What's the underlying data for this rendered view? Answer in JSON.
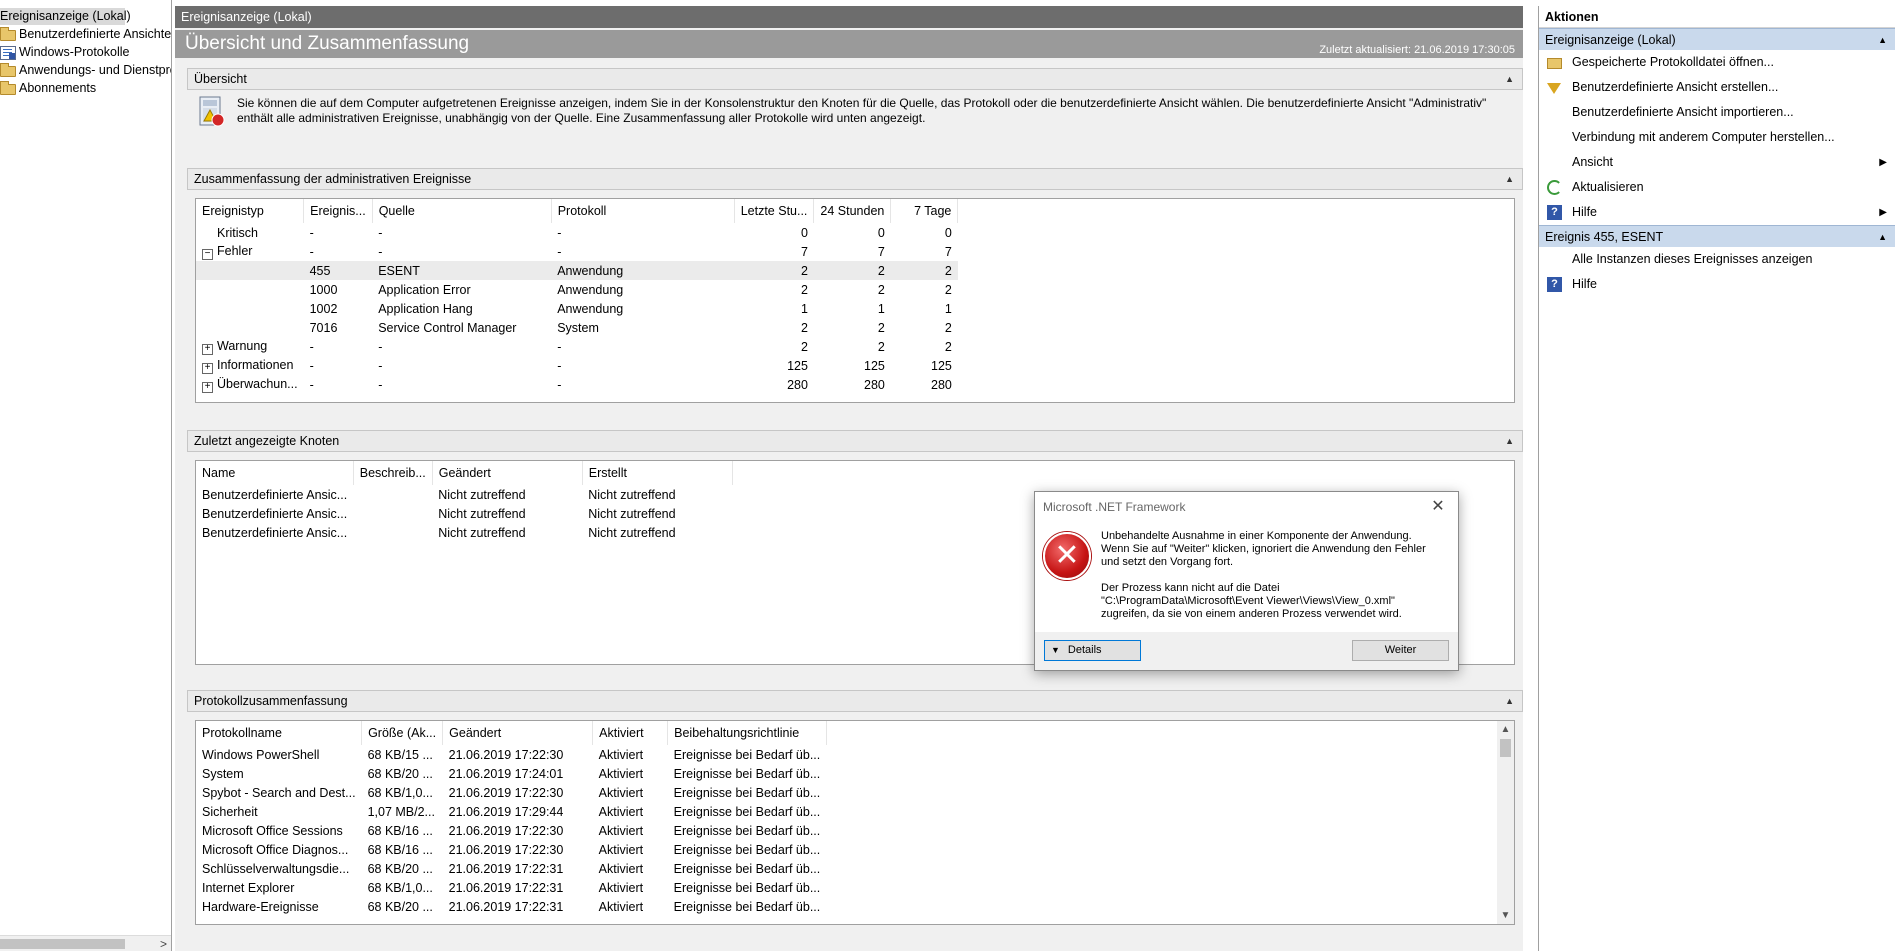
{
  "tree": {
    "items": [
      {
        "label": "Ereignisanzeige (Lokal)",
        "icon": "event-viewer-icon"
      },
      {
        "label": "Benutzerdefinierte Ansichten",
        "icon": "folder-icon"
      },
      {
        "label": "Windows-Protokolle",
        "icon": "log-icon"
      },
      {
        "label": "Anwendungs- und Dienstprotokolle",
        "icon": "folder-icon"
      },
      {
        "label": "Abonnements",
        "icon": "log-icon"
      }
    ]
  },
  "center": {
    "window_title": "Ereignisanzeige (Lokal)",
    "overview_title": "Übersicht und Zusammenfassung",
    "last_updated": "Zuletzt aktualisiert: 21.06.2019 17:30:05"
  },
  "overview": {
    "heading": "Übersicht",
    "text": "Sie können die auf dem Computer aufgetretenen Ereignisse anzeigen, indem Sie in der Konsolenstruktur den Knoten für die Quelle, das Protokoll oder die benutzerdefinierte Ansicht wählen. Die benutzerdefinierte Ansicht \"Administrativ\" enthält alle administrativen Ereignisse, unabhängig von der Quelle. Eine Zusammenfassung aller Protokolle wird unten angezeigt."
  },
  "admin_summary": {
    "heading": "Zusammenfassung der administrativen Ereignisse",
    "columns": [
      "Ereignistyp",
      "Ereignis...",
      "Quelle",
      "Protokoll",
      "Letzte Stu...",
      "24 Stunden",
      "7 Tage"
    ],
    "rows": [
      {
        "type": "Kritisch",
        "id": "-",
        "source": "-",
        "log": "-",
        "hour": "0",
        "day": "0",
        "week": "0",
        "expander": ""
      },
      {
        "type": "Fehler",
        "id": "-",
        "source": "-",
        "log": "-",
        "hour": "7",
        "day": "7",
        "week": "7",
        "expander": "−"
      },
      {
        "type": "",
        "id": "455",
        "source": "ESENT",
        "log": "Anwendung",
        "hour": "2",
        "day": "2",
        "week": "2",
        "expander": ""
      },
      {
        "type": "",
        "id": "1000",
        "source": "Application Error",
        "log": "Anwendung",
        "hour": "2",
        "day": "2",
        "week": "2",
        "expander": ""
      },
      {
        "type": "",
        "id": "1002",
        "source": "Application Hang",
        "log": "Anwendung",
        "hour": "1",
        "day": "1",
        "week": "1",
        "expander": ""
      },
      {
        "type": "",
        "id": "7016",
        "source": "Service Control Manager",
        "log": "System",
        "hour": "2",
        "day": "2",
        "week": "2",
        "expander": ""
      },
      {
        "type": "Warnung",
        "id": "-",
        "source": "-",
        "log": "-",
        "hour": "2",
        "day": "2",
        "week": "2",
        "expander": "+"
      },
      {
        "type": "Informationen",
        "id": "-",
        "source": "-",
        "log": "-",
        "hour": "125",
        "day": "125",
        "week": "125",
        "expander": "+"
      },
      {
        "type": "Überwachun...",
        "id": "-",
        "source": "-",
        "log": "-",
        "hour": "280",
        "day": "280",
        "week": "280",
        "expander": "+"
      }
    ]
  },
  "recent_nodes": {
    "heading": "Zuletzt angezeigte Knoten",
    "columns": [
      "Name",
      "Beschreib...",
      "Geändert",
      "Erstellt"
    ],
    "rows": [
      {
        "name": "Benutzerdefinierte Ansic...",
        "desc": "",
        "changed": "Nicht zutreffend",
        "created": "Nicht zutreffend"
      },
      {
        "name": "Benutzerdefinierte Ansic...",
        "desc": "",
        "changed": "Nicht zutreffend",
        "created": "Nicht zutreffend"
      },
      {
        "name": "Benutzerdefinierte Ansic...",
        "desc": "",
        "changed": "Nicht zutreffend",
        "created": "Nicht zutreffend"
      }
    ]
  },
  "log_summary": {
    "heading": "Protokollzusammenfassung",
    "columns": [
      "Protokollname",
      "Größe (Ak...",
      "Geändert",
      "Aktiviert",
      "Beibehaltungsrichtlinie"
    ],
    "rows": [
      {
        "name": "Windows PowerShell",
        "size": "68 KB/15 ...",
        "changed": "21.06.2019 17:22:30",
        "enabled": "Aktiviert",
        "policy": "Ereignisse bei Bedarf üb..."
      },
      {
        "name": "System",
        "size": "68 KB/20 ...",
        "changed": "21.06.2019 17:24:01",
        "enabled": "Aktiviert",
        "policy": "Ereignisse bei Bedarf üb..."
      },
      {
        "name": "Spybot - Search and Dest...",
        "size": "68 KB/1,0...",
        "changed": "21.06.2019 17:22:30",
        "enabled": "Aktiviert",
        "policy": "Ereignisse bei Bedarf üb..."
      },
      {
        "name": "Sicherheit",
        "size": "1,07 MB/2...",
        "changed": "21.06.2019 17:29:44",
        "enabled": "Aktiviert",
        "policy": "Ereignisse bei Bedarf üb..."
      },
      {
        "name": "Microsoft Office Sessions",
        "size": "68 KB/16 ...",
        "changed": "21.06.2019 17:22:30",
        "enabled": "Aktiviert",
        "policy": "Ereignisse bei Bedarf üb..."
      },
      {
        "name": "Microsoft Office Diagnos...",
        "size": "68 KB/16 ...",
        "changed": "21.06.2019 17:22:30",
        "enabled": "Aktiviert",
        "policy": "Ereignisse bei Bedarf üb..."
      },
      {
        "name": "Schlüsselverwaltungsdie...",
        "size": "68 KB/20 ...",
        "changed": "21.06.2019 17:22:31",
        "enabled": "Aktiviert",
        "policy": "Ereignisse bei Bedarf üb..."
      },
      {
        "name": "Internet Explorer",
        "size": "68 KB/1,0...",
        "changed": "21.06.2019 17:22:31",
        "enabled": "Aktiviert",
        "policy": "Ereignisse bei Bedarf üb..."
      },
      {
        "name": "Hardware-Ereignisse",
        "size": "68 KB/20 ...",
        "changed": "21.06.2019 17:22:31",
        "enabled": "Aktiviert",
        "policy": "Ereignisse bei Bedarf üb..."
      }
    ]
  },
  "actions": {
    "title": "Aktionen",
    "group1": {
      "label": "Ereignisanzeige (Lokal)",
      "items": [
        {
          "label": "Gespeicherte Protokolldatei öffnen...",
          "icon": "open-log-icon"
        },
        {
          "label": "Benutzerdefinierte Ansicht erstellen...",
          "icon": "filter-icon"
        },
        {
          "label": "Benutzerdefinierte Ansicht importieren...",
          "icon": ""
        },
        {
          "label": "Verbindung mit anderem Computer herstellen...",
          "icon": ""
        },
        {
          "label": "Ansicht",
          "icon": "",
          "submenu": true
        },
        {
          "label": "Aktualisieren",
          "icon": "refresh-icon"
        },
        {
          "label": "Hilfe",
          "icon": "help-icon",
          "submenu": true
        }
      ]
    },
    "group2": {
      "label": "Ereignis 455, ESENT",
      "items": [
        {
          "label": "Alle Instanzen dieses Ereignisses anzeigen",
          "icon": ""
        },
        {
          "label": "Hilfe",
          "icon": "help-icon"
        }
      ]
    }
  },
  "dialog": {
    "title": "Microsoft .NET Framework",
    "line1": "Unbehandelte Ausnahme in einer Komponente der Anwendung.",
    "line2": "Wenn Sie auf \"Weiter\" klicken, ignoriert die Anwendung den Fehler",
    "line3": "und setzt den Vorgang fort.",
    "line4": "Der Prozess kann nicht auf die Datei",
    "line5": "\"C:\\ProgramData\\Microsoft\\Event Viewer\\Views\\View_0.xml\"",
    "line6": "zugreifen, da sie von einem anderen Prozess verwendet wird.",
    "details_label": "Details",
    "continue_label": "Weiter"
  }
}
